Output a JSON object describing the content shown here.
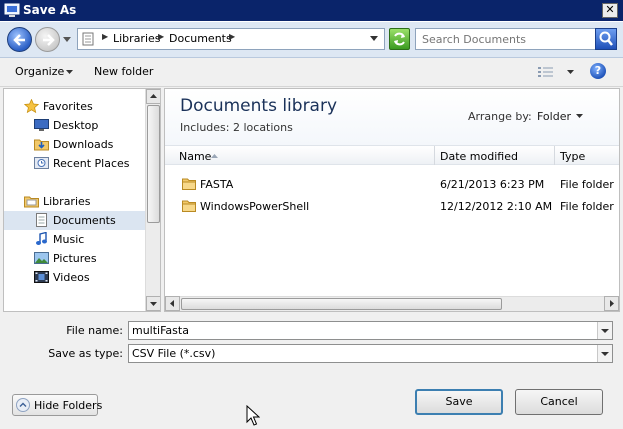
{
  "window": {
    "title": "Save As",
    "close_glyph": "✕"
  },
  "navigation": {
    "breadcrumbs": [
      "Libraries",
      "Documents"
    ],
    "search_placeholder": "Search Documents"
  },
  "toolbar": {
    "organize_label": "Organize",
    "new_folder_label": "New folder",
    "help_glyph": "?"
  },
  "nav_pane": {
    "items": [
      {
        "label": "Favorites",
        "icon": "star-icon",
        "group": true
      },
      {
        "label": "Desktop",
        "icon": "desktop-icon"
      },
      {
        "label": "Downloads",
        "icon": "downloads-icon"
      },
      {
        "label": "Recent Places",
        "icon": "recent-places-icon"
      },
      {
        "label": "Libraries",
        "icon": "libraries-icon",
        "group": true
      },
      {
        "label": "Documents",
        "icon": "documents-icon",
        "selected": true
      },
      {
        "label": "Music",
        "icon": "music-icon"
      },
      {
        "label": "Pictures",
        "icon": "pictures-icon"
      },
      {
        "label": "Videos",
        "icon": "videos-icon"
      }
    ]
  },
  "library": {
    "title": "Documents library",
    "includes_label": "Includes:",
    "includes_link": "2 locations",
    "arrange_label": "Arrange by:",
    "arrange_value": "Folder"
  },
  "columns": {
    "name": "Name",
    "date_modified": "Date modified",
    "type": "Type"
  },
  "files": [
    {
      "name": "FASTA",
      "date_modified": "6/21/2013 6:23 PM",
      "type": "File folder"
    },
    {
      "name": "WindowsPowerShell",
      "date_modified": "12/12/2012 2:10 AM",
      "type": "File folder"
    }
  ],
  "form": {
    "file_name_label": "File name:",
    "file_name_value": "multiFasta",
    "save_type_label": "Save as type:",
    "save_type_value": "CSV File (*.csv)"
  },
  "buttons": {
    "hide_folders": "Hide Folders",
    "save": "Save",
    "cancel": "Cancel"
  }
}
